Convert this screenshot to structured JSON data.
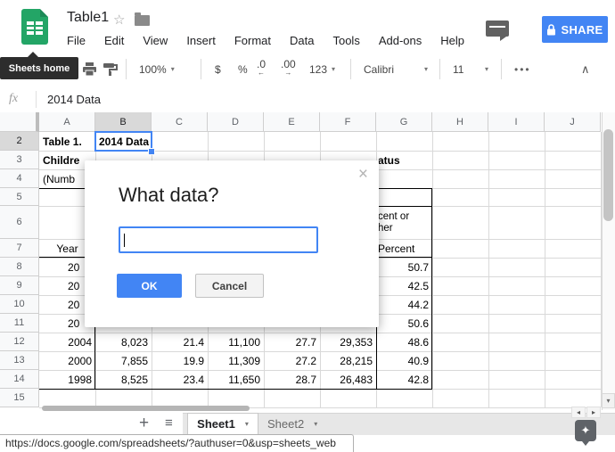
{
  "titlebar": {
    "doc_title": "Table1",
    "star_icon": "☆",
    "menus": [
      "File",
      "Edit",
      "View",
      "Insert",
      "Format",
      "Data",
      "Tools",
      "Add-ons",
      "Help"
    ],
    "share_label": "SHARE"
  },
  "toolbar": {
    "tooltip": "Sheets home",
    "zoom": "100%",
    "currency": "$",
    "percent": "%",
    "decimal_decrease": ".0",
    "decimal_increase": ".00",
    "number_format": "123",
    "font_family": "Calibri",
    "font_size": "11",
    "more": "•••",
    "collapse": "∧"
  },
  "formula_bar": {
    "fx_label": "fx",
    "value": "2014 Data"
  },
  "grid": {
    "column_headers": [
      "A",
      "B",
      "C",
      "D",
      "E",
      "F",
      "G",
      "H",
      "I",
      "J"
    ],
    "selected_column": "B",
    "selected_row": "2",
    "selected_cell": "B2",
    "row_numbers": [
      "2",
      "3",
      "4",
      "5",
      "6",
      "7",
      "8",
      "9",
      "10",
      "11",
      "12",
      "13",
      "14",
      "15"
    ],
    "cells": [
      {
        "r": "2",
        "c": "A",
        "text": "Table 1.",
        "bold": true,
        "align": "left"
      },
      {
        "r": "2",
        "c": "B",
        "text": "2014 Data",
        "bold": true,
        "align": "left"
      },
      {
        "r": "3",
        "c": "A",
        "text": "Childre",
        "bold": true,
        "align": "left"
      },
      {
        "r": "3",
        "c": "G",
        "text": "atus",
        "bold": true,
        "align": "left",
        "indent": 2
      },
      {
        "r": "4",
        "c": "A",
        "text": "(Numb",
        "align": "left"
      },
      {
        "r": "6",
        "c": "G",
        "lines": [
          "cent or",
          "her"
        ],
        "align": "left",
        "indent": 2
      },
      {
        "r": "7",
        "c": "A",
        "text": "Year",
        "align": "center"
      },
      {
        "r": "7",
        "c": "G",
        "text": "Percent",
        "align": "left",
        "indent": 2
      },
      {
        "r": "8",
        "c": "A",
        "text": "20",
        "align": "left",
        "indent": 32
      },
      {
        "r": "8",
        "c": "G",
        "text": "50.7",
        "align": "right"
      },
      {
        "r": "9",
        "c": "A",
        "text": "20",
        "align": "left",
        "indent": 32
      },
      {
        "r": "9",
        "c": "G",
        "text": "42.5",
        "align": "right"
      },
      {
        "r": "10",
        "c": "A",
        "text": "20",
        "align": "left",
        "indent": 32
      },
      {
        "r": "10",
        "c": "G",
        "text": "44.2",
        "align": "right"
      },
      {
        "r": "11",
        "c": "A",
        "text": "20",
        "align": "left",
        "indent": 32
      },
      {
        "r": "11",
        "c": "G",
        "text": "50.6",
        "align": "right"
      },
      {
        "r": "12",
        "c": "A",
        "text": "2004",
        "align": "right"
      },
      {
        "r": "12",
        "c": "B",
        "text": "8,023",
        "align": "right"
      },
      {
        "r": "12",
        "c": "C",
        "text": "21.4",
        "align": "right"
      },
      {
        "r": "12",
        "c": "D",
        "text": "11,100",
        "align": "right"
      },
      {
        "r": "12",
        "c": "E",
        "text": "27.7",
        "align": "right"
      },
      {
        "r": "12",
        "c": "F",
        "text": "29,353",
        "align": "right"
      },
      {
        "r": "12",
        "c": "G",
        "text": "48.6",
        "align": "right"
      },
      {
        "r": "13",
        "c": "A",
        "text": "2000",
        "align": "right"
      },
      {
        "r": "13",
        "c": "B",
        "text": "7,855",
        "align": "right"
      },
      {
        "r": "13",
        "c": "C",
        "text": "19.9",
        "align": "right"
      },
      {
        "r": "13",
        "c": "D",
        "text": "11,309",
        "align": "right"
      },
      {
        "r": "13",
        "c": "E",
        "text": "27.2",
        "align": "right"
      },
      {
        "r": "13",
        "c": "F",
        "text": "28,215",
        "align": "right"
      },
      {
        "r": "13",
        "c": "G",
        "text": "40.9",
        "align": "right"
      },
      {
        "r": "14",
        "c": "A",
        "text": "1998",
        "align": "right"
      },
      {
        "r": "14",
        "c": "B",
        "text": "8,525",
        "align": "right"
      },
      {
        "r": "14",
        "c": "C",
        "text": "23.4",
        "align": "right"
      },
      {
        "r": "14",
        "c": "D",
        "text": "11,650",
        "align": "right"
      },
      {
        "r": "14",
        "c": "E",
        "text": "28.7",
        "align": "right"
      },
      {
        "r": "14",
        "c": "F",
        "text": "26,483",
        "align": "right"
      },
      {
        "r": "14",
        "c": "G",
        "text": "42.8",
        "align": "right"
      }
    ]
  },
  "dialog": {
    "title": "What data?",
    "input_value": "",
    "ok_label": "OK",
    "cancel_label": "Cancel",
    "close_icon": "×"
  },
  "sheet_tabs": {
    "add_label": "+",
    "all_sheets_icon": "≡",
    "tabs": [
      {
        "label": "Sheet1",
        "active": true
      },
      {
        "label": "Sheet2",
        "active": false
      }
    ]
  },
  "scrollbars": {
    "down_arrow": "▾",
    "left_arrow": "◂",
    "right_arrow": "▸"
  },
  "statusbar": {
    "url": "https://docs.google.com/spreadsheets/?authuser=0&usp=sheets_web"
  },
  "explore": {
    "icon": "✦"
  },
  "colors": {
    "accent_blue": "#4285f4",
    "sheets_green": "#23a566"
  }
}
